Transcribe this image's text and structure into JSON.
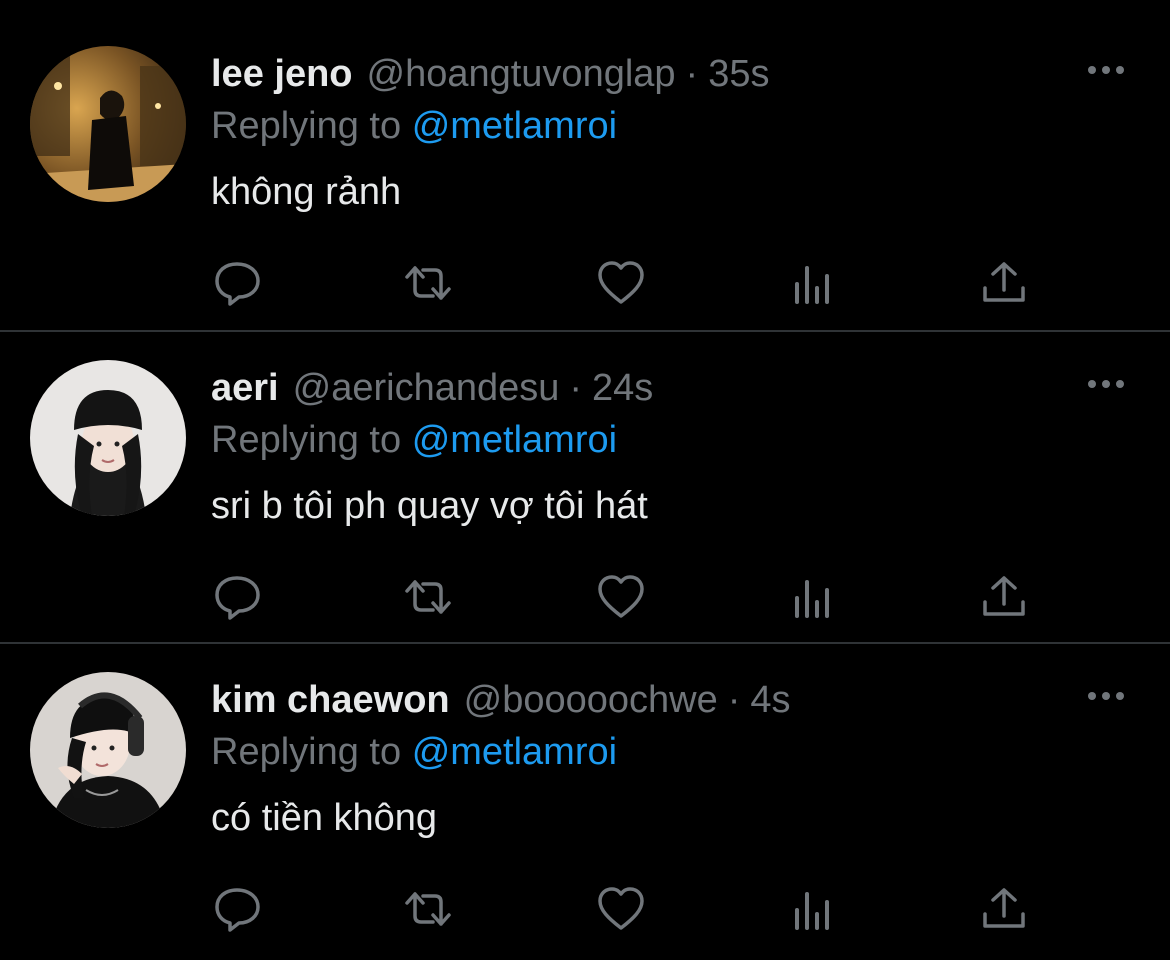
{
  "colors": {
    "background": "#000000",
    "text_primary": "#e7e9ea",
    "text_secondary": "#71767b",
    "mention": "#1d9bf0",
    "divider": "#2f3336"
  },
  "tweets": [
    {
      "name": "lee jeno",
      "handle": "@hoangtuvonglap",
      "separator": "·",
      "time": "35s",
      "replying_prefix": "Replying to",
      "replying_mention": "@metlamroi",
      "text": "không rảnh",
      "avatar": "avatar-night-street-photo"
    },
    {
      "name": "aeri",
      "handle": "@aerichandesu",
      "separator": "·",
      "time": "24s",
      "replying_prefix": "Replying to",
      "replying_mention": "@metlamroi",
      "text": "sri b tôi ph quay vợ tôi hát",
      "avatar": "avatar-girl-black-beanie"
    },
    {
      "name": "kim chaewon",
      "handle": "@booooochwe",
      "separator": "·",
      "time": "4s",
      "replying_prefix": "Replying to",
      "replying_mention": "@metlamroi",
      "text": "có tiền không",
      "avatar": "avatar-girl-headphones"
    }
  ],
  "icons": {
    "more": "more-dots-icon",
    "reply": "reply-bubble-icon",
    "retweet": "retweet-icon",
    "like": "heart-icon",
    "views": "views-bars-icon",
    "share": "share-upload-icon"
  }
}
